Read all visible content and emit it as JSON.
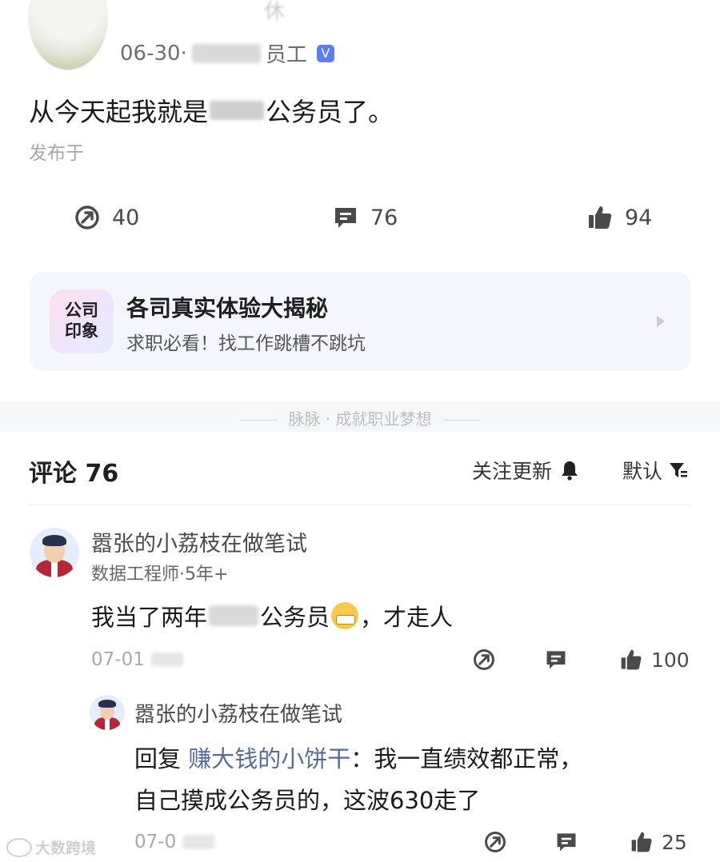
{
  "post": {
    "author_name": "休",
    "date": "06-30·",
    "role": "员工",
    "verified_badge": "V",
    "text_before": "从今天起我就是",
    "text_after": "公务员了。",
    "location_label": "发布于"
  },
  "actions": {
    "shares": "40",
    "comments": "76",
    "likes": "94"
  },
  "promo": {
    "logo_line1": "公司",
    "logo_line2": "印象",
    "title": "各司真实体验大揭秘",
    "subtitle": "求职必看！找工作跳槽不跳坑"
  },
  "divider_text": "脉脉 · 成就职业梦想",
  "comments_section": {
    "title": "评论 76",
    "follow_label": "关注更新",
    "sort_label": "默认"
  },
  "comment": {
    "author": "嚣张的小荔枝在做笔试",
    "title": "数据工程师·5年+",
    "text_before": "我当了两年",
    "text_middle": "公务员",
    "text_after": "，才走人",
    "time": "07-01",
    "likes": "100"
  },
  "reply": {
    "author": "嚣张的小荔枝在做笔试",
    "reply_prefix": "回复",
    "reply_to": "赚大钱的小饼干",
    "line1_text": "：我一直绩效都正常，",
    "line2_text": "自己摸成公务员的，这波630走了",
    "time": "07-0",
    "likes": "25"
  },
  "watermark": "大数跨境",
  "colors": {
    "link_blue": "#576b95",
    "verified_blue": "#5b7df0",
    "promo_bg": "#f3f6fd"
  }
}
